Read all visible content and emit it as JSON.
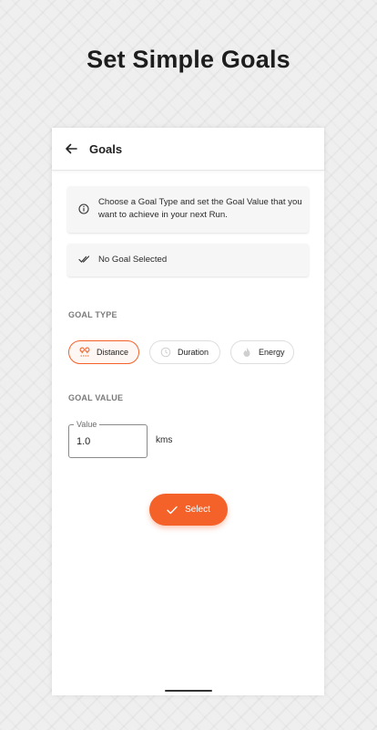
{
  "headline": "Set Simple Goals",
  "appbar": {
    "title": "Goals",
    "back_icon": "arrow-left-icon"
  },
  "info_card": {
    "icon": "info-icon",
    "text": "Choose a Goal Type and set the Goal Value that you want to achieve in your next Run."
  },
  "status_card": {
    "icon": "double-check-icon",
    "text": "No Goal Selected"
  },
  "goal_type": {
    "label": "GOAL TYPE",
    "selected": "Distance",
    "chips": [
      {
        "label": "Distance",
        "icon": "distance-pins-icon"
      },
      {
        "label": "Duration",
        "icon": "clock-icon"
      },
      {
        "label": "Energy",
        "icon": "flame-icon"
      }
    ]
  },
  "goal_value": {
    "label": "GOAL VALUE",
    "field_label": "Value",
    "value": "1.0",
    "unit": "kms"
  },
  "select_button": {
    "label": "Select",
    "icon": "check-icon"
  },
  "colors": {
    "accent": "#f4622a",
    "text": "#1f1f1f",
    "muted": "#7a7a7a"
  }
}
